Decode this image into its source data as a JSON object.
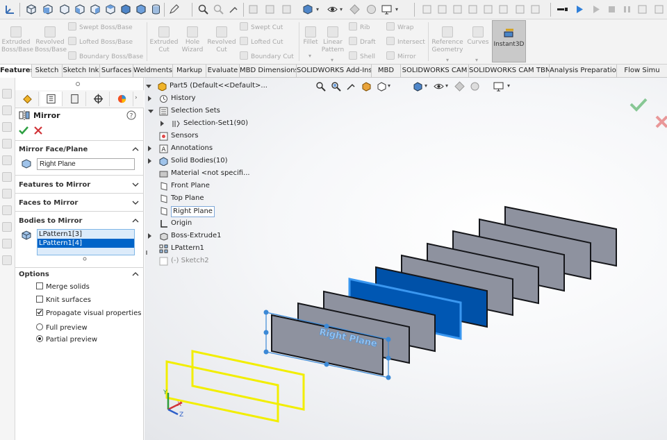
{
  "ribbon": {
    "extruded_boss": [
      "Extruded",
      "Boss/Base"
    ],
    "revolved_boss": [
      "Revolved",
      "Boss/Base"
    ],
    "swept_boss": "Swept Boss/Base",
    "lofted_boss": "Lofted Boss/Base",
    "boundary_boss": "Boundary Boss/Base",
    "extruded_cut": [
      "Extruded",
      "Cut"
    ],
    "hole_wizard": [
      "Hole",
      "Wizard"
    ],
    "revolved_cut": [
      "Revolved",
      "Cut"
    ],
    "swept_cut": "Swept Cut",
    "lofted_cut": "Lofted Cut",
    "boundary_cut": "Boundary Cut",
    "fillet": "Fillet",
    "linear_pattern": [
      "Linear",
      "Pattern"
    ],
    "rib": "Rib",
    "draft": "Draft",
    "shell": "Shell",
    "wrap": "Wrap",
    "intersect": "Intersect",
    "mirror": "Mirror",
    "reference_geometry": [
      "Reference",
      "Geometry"
    ],
    "curves": "Curves",
    "instant3d": "Instant3D"
  },
  "tabs": [
    {
      "label": "Features",
      "active": true
    },
    {
      "label": "Sketch"
    },
    {
      "label": "Sketch Ink"
    },
    {
      "label": "Surfaces"
    },
    {
      "label": "Weldments"
    },
    {
      "label": "Markup"
    },
    {
      "label": "Evaluate"
    },
    {
      "label": "MBD Dimensions"
    },
    {
      "label": "SOLIDWORKS Add-Ins"
    },
    {
      "label": "MBD"
    },
    {
      "label": "SOLIDWORKS CAM"
    },
    {
      "label": "SOLIDWORKS CAM TBM"
    },
    {
      "label": "Analysis Preparation"
    },
    {
      "label": "Flow Simu"
    }
  ],
  "property_manager": {
    "title": "Mirror",
    "help_glyph": "?",
    "mirror_face_plane": {
      "header": "Mirror Face/Plane",
      "value": "Right Plane"
    },
    "features_to_mirror": {
      "header": "Features to Mirror"
    },
    "faces_to_mirror": {
      "header": "Faces to Mirror"
    },
    "bodies_to_mirror": {
      "header": "Bodies to Mirror",
      "items": [
        "LPattern1[3]",
        "LPattern1[4]"
      ],
      "selected_index": 1
    },
    "options": {
      "header": "Options",
      "merge_solids": {
        "label": "Merge solids",
        "checked": false
      },
      "knit_surfaces": {
        "label": "Knit surfaces",
        "checked": false
      },
      "propagate_visual": {
        "label": "Propagate visual properties",
        "checked": true
      },
      "full_preview": {
        "label": "Full preview",
        "selected": false
      },
      "partial_preview": {
        "label": "Partial preview",
        "selected": true
      }
    }
  },
  "feature_tree": {
    "root": "Part5  (Default<<Default>...",
    "items": [
      {
        "label": "History",
        "expander": "closed",
        "indent": 1,
        "icon": "history-icon"
      },
      {
        "label": "Selection Sets",
        "expander": "open",
        "indent": 1,
        "icon": "selection-sets-icon"
      },
      {
        "label": "Selection-Set1(90)",
        "expander": "closed",
        "indent": 2,
        "icon": "selection-set-icon"
      },
      {
        "label": "Sensors",
        "expander": "none",
        "indent": 1,
        "icon": "sensors-icon"
      },
      {
        "label": "Annotations",
        "expander": "closed",
        "indent": 1,
        "icon": "annotations-icon"
      },
      {
        "label": "Solid Bodies(10)",
        "expander": "closed",
        "indent": 1,
        "icon": "solid-bodies-icon"
      },
      {
        "label": "Material <not specifi...",
        "expander": "none",
        "indent": 1,
        "icon": "material-icon"
      },
      {
        "label": "Front Plane",
        "expander": "none",
        "indent": 1,
        "icon": "plane-icon"
      },
      {
        "label": "Top Plane",
        "expander": "none",
        "indent": 1,
        "icon": "plane-icon"
      },
      {
        "label": "Right Plane",
        "expander": "none",
        "indent": 1,
        "icon": "plane-icon",
        "selected": true
      },
      {
        "label": "Origin",
        "expander": "none",
        "indent": 1,
        "icon": "origin-icon"
      },
      {
        "label": "Boss-Extrude1",
        "expander": "closed",
        "indent": 1,
        "icon": "boss-extrude-icon"
      },
      {
        "label": "LPattern1",
        "expander": "none",
        "indent": 1,
        "icon": "linear-pattern-icon"
      },
      {
        "label": "(-) Sketch2",
        "expander": "none",
        "indent": 1,
        "icon": "sketch-icon",
        "dim": true
      }
    ]
  },
  "viewport": {
    "plane_label": "Right Plane",
    "axis_labels": {
      "x": "X",
      "y": "Y",
      "z": "Z"
    },
    "colors": {
      "plate_face": "#8e929f",
      "plate_edge": "#15161a",
      "selected_face": "#0051a8",
      "selected_edge": "#3a97f0",
      "mirror_plane": "#f2ee00",
      "handle": "#3c89d6",
      "ok_check": "#2ea043",
      "cancel_x": "#e04b4b"
    }
  }
}
